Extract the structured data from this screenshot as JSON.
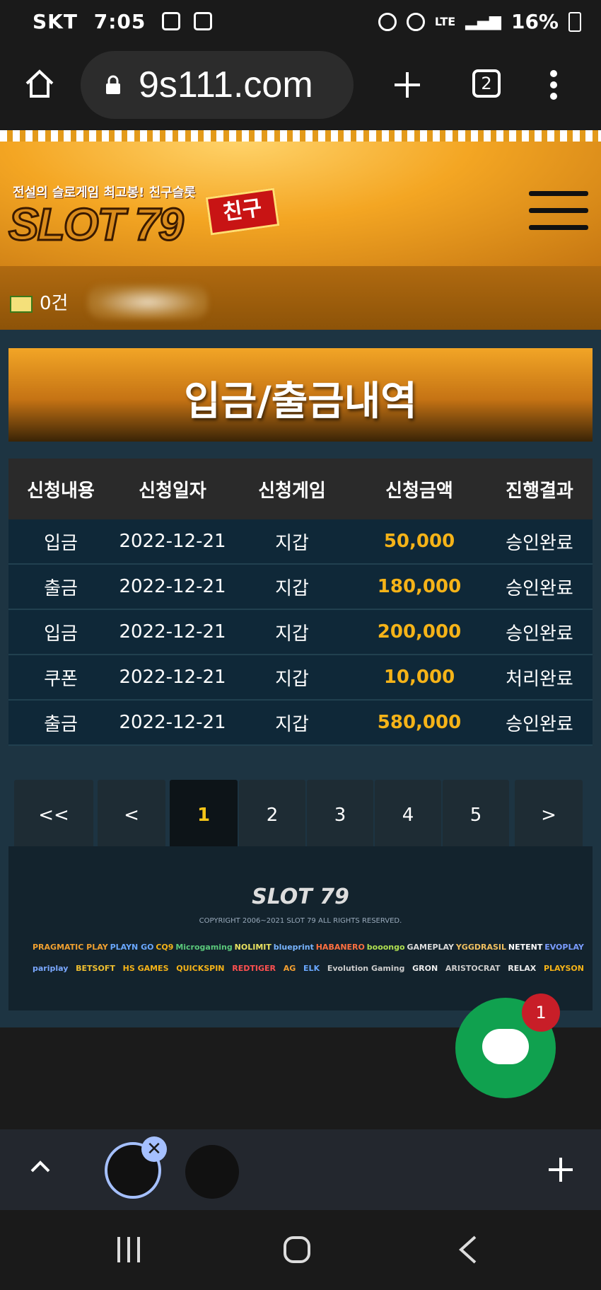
{
  "status_bar": {
    "carrier": "SKT",
    "time": "7:05",
    "network": "LTE",
    "battery": "16%"
  },
  "browser": {
    "url": "9s111.com",
    "tab_count": "2"
  },
  "site": {
    "logo_tagline": "전설의 슬로게임 최고봉! 친구슬롯",
    "logo_text": "SLOT 79",
    "logo_badge": "친구",
    "message_count": "0건"
  },
  "page_title": "입금/출금내역",
  "table": {
    "headers": [
      "신청내용",
      "신청일자",
      "신청게임",
      "신청금액",
      "진행결과"
    ],
    "rows": [
      [
        "입금",
        "2022-12-21",
        "지갑",
        "50,000",
        "승인완료"
      ],
      [
        "출금",
        "2022-12-21",
        "지갑",
        "180,000",
        "승인완료"
      ],
      [
        "입금",
        "2022-12-21",
        "지갑",
        "200,000",
        "승인완료"
      ],
      [
        "쿠폰",
        "2022-12-21",
        "지갑",
        "10,000",
        "처리완료"
      ],
      [
        "출금",
        "2022-12-21",
        "지갑",
        "580,000",
        "승인완료"
      ]
    ]
  },
  "pagination": {
    "first": "<<",
    "prev": "<",
    "pages": [
      "1",
      "2",
      "3",
      "4",
      "5"
    ],
    "current": "1",
    "next": ">"
  },
  "footer": {
    "logo_text": "SLOT 79",
    "copyright": "COPYRIGHT 2006~2021 SLOT 79 ALL RIGHTS RESERVED.",
    "brands_row1": [
      "PRAGMATIC PLAY",
      "PLAYN GO",
      "CQ9",
      "Microgaming",
      "NOLIMIT",
      "blueprint",
      "HABANERO",
      "booongo",
      "GAMEPLAY",
      "YGGDRASIL",
      "NETENT",
      "EVOPLAY"
    ],
    "brands_row2": [
      "pariplay",
      "BETSOFT",
      "HS GAMES",
      "QUICKSPIN",
      "REDTIGER",
      "AG",
      "ELK",
      "Evolution Gaming",
      "GRON",
      "ARISTOCRAT",
      "RELAX",
      "PLAYSON"
    ]
  },
  "chat": {
    "badge": "1"
  },
  "colors": {
    "accent_gold": "#f5b318",
    "chat_green": "#10a14f",
    "badge_red": "#c81e28"
  }
}
